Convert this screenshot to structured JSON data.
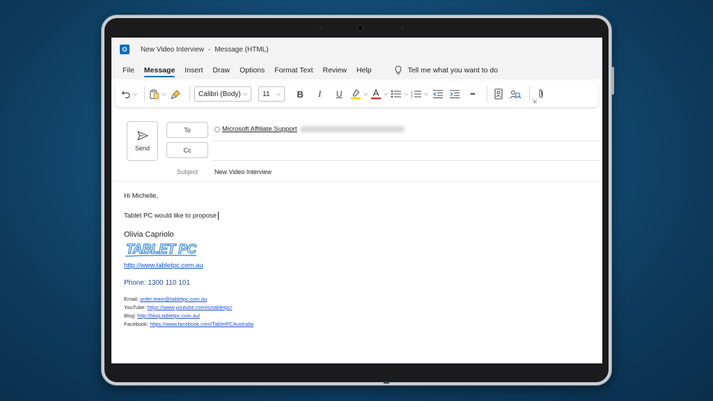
{
  "window": {
    "title": "New Video Interview",
    "separator": "-",
    "subtitle": "Message (HTML)",
    "app_logo_letter": "O"
  },
  "menu": {
    "items": [
      "File",
      "Message",
      "Insert",
      "Draw",
      "Options",
      "Format Text",
      "Review",
      "Help"
    ],
    "active": "Message",
    "tell_me": "Tell me what you want to do"
  },
  "ribbon": {
    "font_name": "Calibri (Body)",
    "font_size": "11",
    "bold": "B",
    "italic": "I",
    "underline": "U",
    "more": "•••",
    "highlight_color": "#f2d200",
    "font_color": "#d13438"
  },
  "compose": {
    "send_label": "Send",
    "to_label": "To",
    "cc_label": "Cc",
    "to_recipient": "Microsoft Affiliate Support",
    "subject_label": "Subject",
    "subject_value": "New Video Interview"
  },
  "body": {
    "greeting": "Hi Michelle,",
    "line1": "Tablet PC would like to propose",
    "signature_name": "Olivia Capriolo",
    "logo_text": "TABLET PC",
    "website": "http://www.tabletpc.com.au",
    "phone": "Phone: 1300 110 101",
    "email_label": "Email:",
    "email": "order.team@tabletpc.com.au",
    "youtube_label": "YouTube:",
    "youtube": "https://www.youtube.com/oztabletpc/",
    "blog_label": "Blog:",
    "blog": "http://blog.tabletpc.com.au/",
    "facebook_label": "Facebook:",
    "facebook": "https://www.facebook.com/TabletPCAustralia"
  },
  "colors": {
    "accent": "#0f6cbd",
    "link": "#1155cc",
    "logo_blue": "#3d8fd8"
  }
}
